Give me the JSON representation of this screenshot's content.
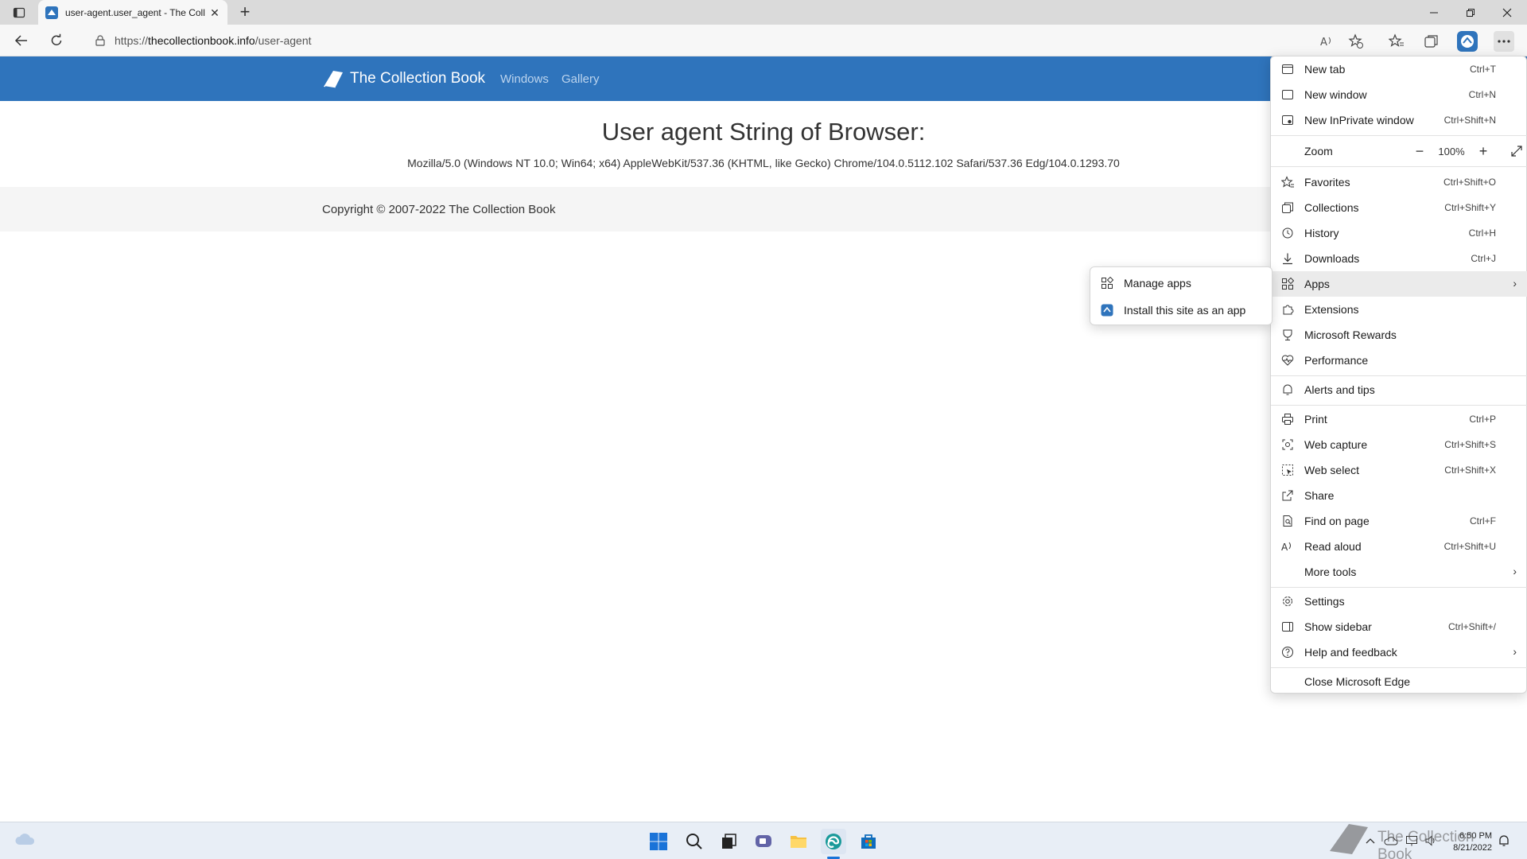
{
  "browser": {
    "tab_title": "user-agent.user_agent - The Coll",
    "url_prefix": "https://",
    "url_domain": "thecollectionbook.info",
    "url_path": "/user-agent"
  },
  "site": {
    "brand": "The Collection Book",
    "nav": [
      "Windows",
      "Gallery"
    ],
    "heading": "User agent String of Browser:",
    "ua_string": "Mozilla/5.0 (Windows NT 10.0; Win64; x64) AppleWebKit/537.36 (KHTML, like Gecko) Chrome/104.0.5112.102 Safari/537.36 Edg/104.0.1293.70",
    "copyright": "Copyright © 2007-2022 The Collection Book"
  },
  "menu": {
    "items": [
      {
        "label": "New tab",
        "shortcut": "Ctrl+T",
        "icon": "new-tab-icon"
      },
      {
        "label": "New window",
        "shortcut": "Ctrl+N",
        "icon": "new-window-icon"
      },
      {
        "label": "New InPrivate window",
        "shortcut": "Ctrl+Shift+N",
        "icon": "inprivate-icon"
      },
      {
        "label": "Zoom",
        "shortcut": "",
        "icon": ""
      },
      {
        "label": "Favorites",
        "shortcut": "Ctrl+Shift+O",
        "icon": "favorites-icon"
      },
      {
        "label": "Collections",
        "shortcut": "Ctrl+Shift+Y",
        "icon": "collections-icon"
      },
      {
        "label": "History",
        "shortcut": "Ctrl+H",
        "icon": "history-icon"
      },
      {
        "label": "Downloads",
        "shortcut": "Ctrl+J",
        "icon": "downloads-icon"
      },
      {
        "label": "Apps",
        "shortcut": "",
        "icon": "apps-icon"
      },
      {
        "label": "Extensions",
        "shortcut": "",
        "icon": "extensions-icon"
      },
      {
        "label": "Microsoft Rewards",
        "shortcut": "",
        "icon": "rewards-icon"
      },
      {
        "label": "Performance",
        "shortcut": "",
        "icon": "performance-icon"
      },
      {
        "label": "Alerts and tips",
        "shortcut": "",
        "icon": "bell-icon"
      },
      {
        "label": "Print",
        "shortcut": "Ctrl+P",
        "icon": "print-icon"
      },
      {
        "label": "Web capture",
        "shortcut": "Ctrl+Shift+S",
        "icon": "web-capture-icon"
      },
      {
        "label": "Web select",
        "shortcut": "Ctrl+Shift+X",
        "icon": "web-select-icon"
      },
      {
        "label": "Share",
        "shortcut": "",
        "icon": "share-icon"
      },
      {
        "label": "Find on page",
        "shortcut": "Ctrl+F",
        "icon": "find-icon"
      },
      {
        "label": "Read aloud",
        "shortcut": "Ctrl+Shift+U",
        "icon": "read-aloud-icon"
      },
      {
        "label": "More tools",
        "shortcut": "",
        "icon": ""
      },
      {
        "label": "Settings",
        "shortcut": "",
        "icon": "gear-icon"
      },
      {
        "label": "Show sidebar",
        "shortcut": "Ctrl+Shift+/",
        "icon": "sidebar-icon"
      },
      {
        "label": "Help and feedback",
        "shortcut": "",
        "icon": "help-icon"
      },
      {
        "label": "Close Microsoft Edge",
        "shortcut": "",
        "icon": ""
      }
    ],
    "zoom_value": "100%"
  },
  "apps_submenu": {
    "items": [
      {
        "label": "Manage apps",
        "icon": "apps-icon"
      },
      {
        "label": "Install this site as an app",
        "icon": "site-app-icon"
      }
    ]
  },
  "taskbar": {
    "time": "6:50 PM",
    "date": "8/21/2022"
  },
  "watermark": {
    "text": "The Collection Book"
  },
  "colors": {
    "header_blue": "#2f74bc",
    "menu_highlight": "#ebebeb",
    "taskbar": "#e8eef6"
  }
}
